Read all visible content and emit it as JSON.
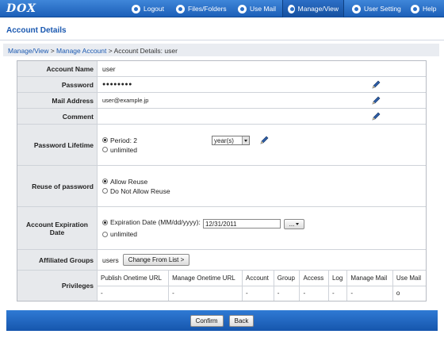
{
  "app": {
    "logo": "DOX"
  },
  "nav": [
    {
      "label": "Logout"
    },
    {
      "label": "Files/Folders"
    },
    {
      "label": "Use Mail"
    },
    {
      "label": "Manage/View"
    },
    {
      "label": "User Setting"
    },
    {
      "label": "Help"
    }
  ],
  "page": {
    "title": "Account Details"
  },
  "breadcrumb": {
    "part1": "Manage/View",
    "sep1": " > ",
    "part2": "Manage Account",
    "sep2": " > ",
    "part3": "Account Details: user"
  },
  "form": {
    "account_name": {
      "label": "Account Name",
      "value": "user"
    },
    "password": {
      "label": "Password",
      "value": "●●●●●●●●"
    },
    "mail": {
      "label": "Mail Address",
      "value": "user@example.jp"
    },
    "comment": {
      "label": "Comment",
      "value": ""
    },
    "lifetime": {
      "label": "Password Lifetime",
      "option_period": "Period: 2",
      "option_unlimited": "unlimited",
      "unit_selected": "year(s)"
    },
    "reuse": {
      "label": "Reuse of password",
      "option_allow": "Allow Reuse",
      "option_deny": "Do Not Allow Reuse"
    },
    "expiration": {
      "label": "Account Expiration Date",
      "option_date": "Expiration Date (MM/dd/yyyy):",
      "date_value": "12/31/2011",
      "picker_label": "...",
      "option_unlimited": "unlimited"
    },
    "groups": {
      "label": "Affiliated Groups",
      "value": "users",
      "button": "Change From List >"
    },
    "privileges": {
      "label": "Privileges",
      "headers": [
        "Publish Onetime URL",
        "Manage Onetime URL",
        "Account",
        "Group",
        "Access",
        "Log",
        "Manage Mail",
        "Use Mail"
      ],
      "values": [
        "-",
        "-",
        "-",
        "-",
        "-",
        "-",
        "-",
        "o"
      ]
    }
  },
  "footer": {
    "confirm": "Confirm",
    "back": "Back"
  },
  "colors": {
    "brand_blue": "#1c5fb8",
    "title_blue": "#1a58b0",
    "label_bg": "#e7e9ec"
  }
}
